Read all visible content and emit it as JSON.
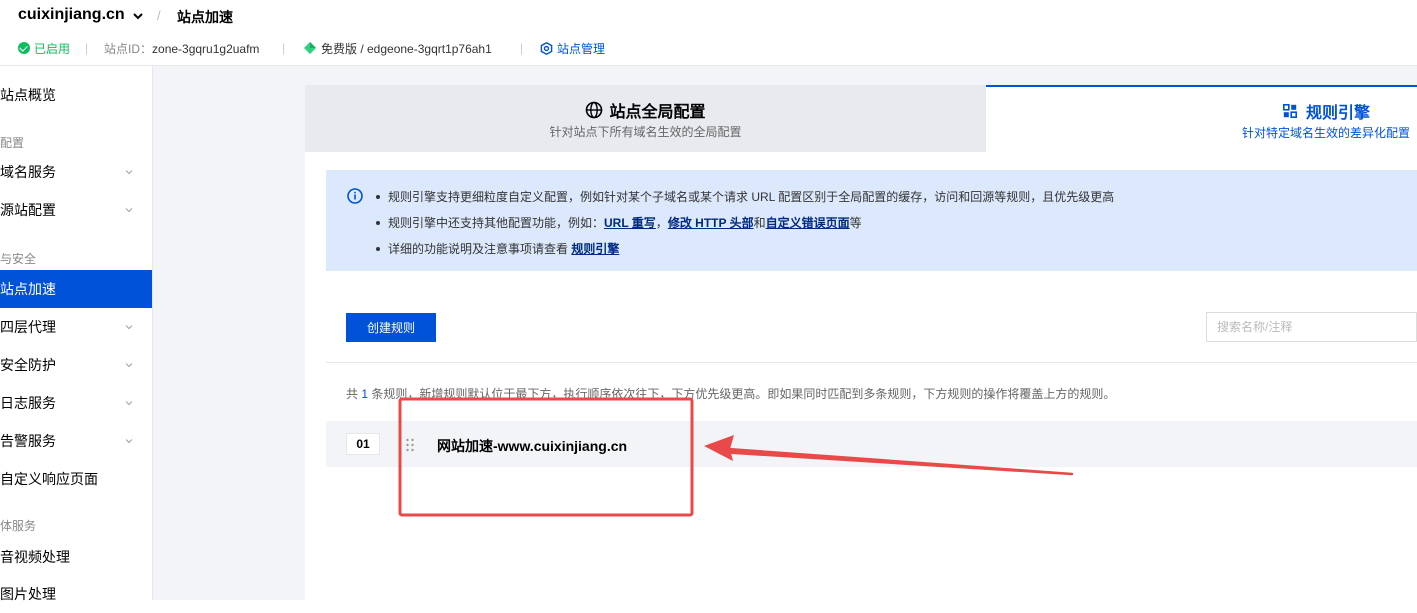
{
  "header": {
    "site_name": "cuixinjiang.cn",
    "breadcrumb_sep": "/",
    "breadcrumb_current": "站点加速",
    "status": "已启用",
    "site_id_label": "站点ID：",
    "site_id": "zone-3gqru1g2uafm",
    "plan": "免费版 / edgeone-3gqrt1p76ah1",
    "manage": "站点管理"
  },
  "sidebar": {
    "items": [
      {
        "label": "站点概览"
      },
      {
        "label": "域名服务"
      },
      {
        "label": "源站配置"
      },
      {
        "label": "站点加速"
      },
      {
        "label": "四层代理"
      },
      {
        "label": "安全防护"
      },
      {
        "label": "日志服务"
      },
      {
        "label": "告警服务"
      },
      {
        "label": "自定义响应页面"
      },
      {
        "label": "音视频处理"
      },
      {
        "label": "图片处理"
      }
    ],
    "groups": [
      "配置",
      "与安全",
      "体服务"
    ]
  },
  "tabs": {
    "global_title": "站点全局配置",
    "global_desc": "针对站点下所有域名生效的全局配置",
    "rules_title": "规则引擎",
    "rules_desc": "针对特定域名生效的差异化配置"
  },
  "info": {
    "line1": "规则引擎支持更细粒度自定义配置，例如针对某个子域名或某个请求 URL 配置区别于全局配置的缓存，访问和回源等规则，且优先级更高",
    "line2_prefix": "规则引擎中还支持其他配置功能，例如：",
    "line2_link1": "URL 重写",
    "line2_sep": "，",
    "line2_link2": "修改 HTTP 头部",
    "line2_and": "和",
    "line2_link3": "自定义错误页面",
    "line2_suffix": "等",
    "line3_prefix": "详细的功能说明及注意事项请查看 ",
    "line3_link": "规则引擎"
  },
  "toolbar": {
    "create_label": "创建规则",
    "search_placeholder": "搜索名称/注释"
  },
  "summary": {
    "prefix": "共 ",
    "count": "1",
    "suffix": " 条规则，新增规则默认位于最下方，执行顺序依次往下，下方优先级更高。即如果同时匹配到多条规则，下方规则的操作将覆盖上方的规则。"
  },
  "rules": [
    {
      "index": "01",
      "name": "网站加速-www.cuixinjiang.cn"
    }
  ],
  "colors": {
    "accent": "#0052d9",
    "success": "#0abf5b",
    "annotation": "#e84a4a",
    "info_bg": "#dce9fd"
  }
}
